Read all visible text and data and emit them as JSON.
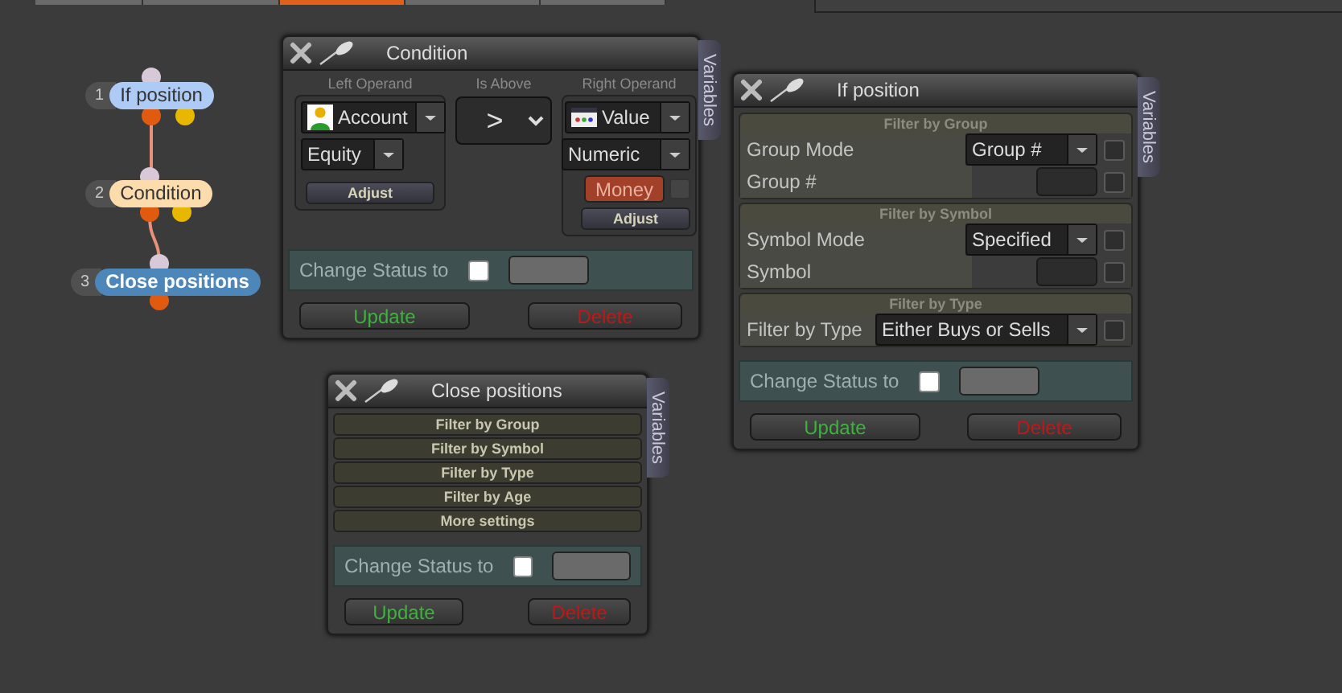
{
  "top_tabs": [
    {
      "selected": false
    },
    {
      "selected": false
    },
    {
      "selected": true
    },
    {
      "selected": false
    },
    {
      "selected": false
    }
  ],
  "nodes": [
    {
      "number": "1",
      "label": "If position",
      "color": "#aecbf6"
    },
    {
      "number": "2",
      "label": "Condition",
      "color": "#fcdcac"
    },
    {
      "number": "3",
      "label": "Close positions",
      "color": "#4d86b9"
    }
  ],
  "windows": [
    {
      "kind": "condition",
      "title": "Condition",
      "side_tab": "Variables",
      "left_operand": {
        "heading": "Left Operand",
        "source": "Account",
        "field": "Equity",
        "adjust": "Adjust"
      },
      "comparison": {
        "heading": "Is Above",
        "operator": ">"
      },
      "right_operand": {
        "heading": "Right Operand",
        "source": "Value",
        "type": "Numeric",
        "unit": "Money",
        "unit_checked": false,
        "adjust": "Adjust"
      },
      "status": {
        "label": "Change Status to",
        "checked": false
      },
      "buttons": {
        "update": "Update",
        "delete": "Delete"
      }
    },
    {
      "kind": "filters",
      "title": "If position",
      "side_tab": "Variables",
      "sections": [
        {
          "heading": "Filter by Group",
          "rows": [
            {
              "kind": "select",
              "label": "Group Mode",
              "value": "Group #",
              "checked": false
            },
            {
              "kind": "input",
              "label": "Group #",
              "checked": false
            }
          ]
        },
        {
          "heading": "Filter by Symbol",
          "rows": [
            {
              "kind": "select",
              "label": "Symbol Mode",
              "value": "Specified",
              "checked": false
            },
            {
              "kind": "input",
              "label": "Symbol",
              "checked": false
            }
          ]
        },
        {
          "heading": "Filter by Type",
          "rows": [
            {
              "kind": "select",
              "label": "Filter by Type",
              "value": "Either Buys or Sells",
              "checked": false
            }
          ]
        }
      ],
      "status": {
        "label": "Change Status to",
        "checked": false
      },
      "buttons": {
        "update": "Update",
        "delete": "Delete"
      }
    },
    {
      "kind": "sections",
      "title": "Close positions",
      "side_tab": "Variables",
      "sections": [
        "Filter by Group",
        "Filter by Symbol",
        "Filter by Type",
        "Filter by Age",
        "More settings"
      ],
      "status": {
        "label": "Change Status to",
        "checked": false
      },
      "buttons": {
        "update": "Update",
        "delete": "Delete"
      }
    }
  ]
}
